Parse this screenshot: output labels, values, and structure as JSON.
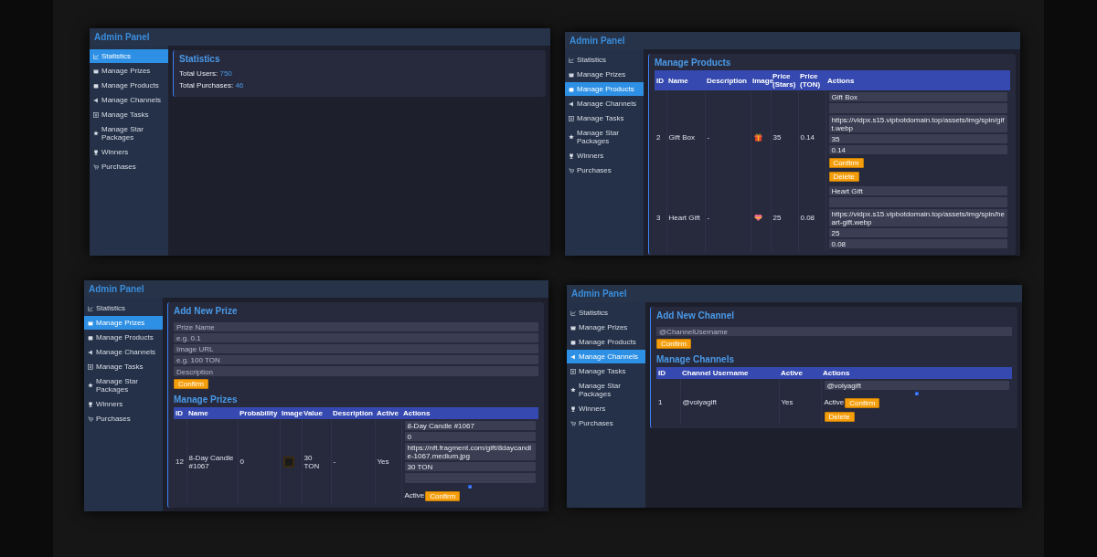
{
  "panels": [
    {
      "kind": "statistics",
      "title": "Admin Panel",
      "sidebar": [
        {
          "label": "Statistics",
          "selected": true
        },
        {
          "label": "Manage Prizes",
          "selected": false
        },
        {
          "label": "Manage Products",
          "selected": false
        },
        {
          "label": "Manage Channels",
          "selected": false
        },
        {
          "label": "Manage Tasks",
          "selected": false
        },
        {
          "label": "Manage Star Packages",
          "selected": false
        },
        {
          "label": "Winners",
          "selected": false
        },
        {
          "label": "Purchases",
          "selected": false
        }
      ],
      "heading": "Statistics",
      "stats": [
        {
          "label": "Total Users:",
          "value": "750"
        },
        {
          "label": "Total Purchases:",
          "value": "46"
        }
      ]
    },
    {
      "kind": "products",
      "title": "Admin Panel",
      "sidebar": [
        {
          "label": "Statistics",
          "selected": false
        },
        {
          "label": "Manage Prizes",
          "selected": false
        },
        {
          "label": "Manage Products",
          "selected": true
        },
        {
          "label": "Manage Channels",
          "selected": false
        },
        {
          "label": "Manage Tasks",
          "selected": false
        },
        {
          "label": "Manage Star Packages",
          "selected": false
        },
        {
          "label": "Winners",
          "selected": false
        },
        {
          "label": "Purchases",
          "selected": false
        }
      ],
      "table": {
        "heading": "Manage Products",
        "columns": [
          "ID",
          "Name",
          "Description",
          "Image",
          "Price (Stars)",
          "Price (TON)",
          "Actions"
        ],
        "rows": [
          {
            "cells": [
              {
                "kind": "text",
                "text": "2"
              },
              {
                "kind": "text",
                "text": "Gift Box"
              },
              {
                "kind": "text",
                "text": "-"
              },
              {
                "kind": "gift"
              },
              {
                "kind": "text",
                "text": "35"
              },
              {
                "kind": "text",
                "text": "0.14"
              }
            ],
            "edit": {
              "fields": [
                {
                  "kind": "input",
                  "value": "Gift Box"
                },
                {
                  "kind": "textarea"
                },
                {
                  "kind": "input",
                  "value": "https://vidpx.s15.vipbotdomain.top/assets/img/spin/gift.webp"
                },
                {
                  "kind": "input",
                  "value": "35"
                },
                {
                  "kind": "input",
                  "value": "0.14"
                }
              ],
              "buttons": [
                "Confirm",
                "Delete"
              ]
            }
          },
          {
            "cells": [
              {
                "kind": "text",
                "text": "3"
              },
              {
                "kind": "text",
                "text": "Heart Gift"
              },
              {
                "kind": "text",
                "text": "-"
              },
              {
                "kind": "heart"
              },
              {
                "kind": "text",
                "text": "25"
              },
              {
                "kind": "text",
                "text": "0.08"
              }
            ],
            "edit": {
              "fields": [
                {
                  "kind": "input",
                  "value": "Heart Gift"
                },
                {
                  "kind": "textarea"
                },
                {
                  "kind": "input",
                  "value": "https://vidpx.s15.vipbotdomain.top/assets/img/spin/heart-gift.webp"
                },
                {
                  "kind": "input",
                  "value": "25"
                },
                {
                  "kind": "input",
                  "value": "0.08"
                }
              ]
            }
          }
        ]
      }
    },
    {
      "kind": "prizes",
      "title": "Admin Panel",
      "sidebar": [
        {
          "label": "Statistics",
          "selected": false
        },
        {
          "label": "Manage Prizes",
          "selected": true
        },
        {
          "label": "Manage Products",
          "selected": false
        },
        {
          "label": "Manage Channels",
          "selected": false
        },
        {
          "label": "Manage Tasks",
          "selected": false
        },
        {
          "label": "Manage Star Packages",
          "selected": false
        },
        {
          "label": "Winners",
          "selected": false
        },
        {
          "label": "Purchases",
          "selected": false
        }
      ],
      "add_form": {
        "heading": "Add New Prize",
        "fields": [
          {
            "kind": "input",
            "placeholder": "Prize Name"
          },
          {
            "kind": "input",
            "placeholder": "e.g. 0.1"
          },
          {
            "kind": "input",
            "placeholder": "Image URL"
          },
          {
            "kind": "input",
            "placeholder": "e.g. 100 TON"
          },
          {
            "kind": "textarea",
            "placeholder": "Description"
          }
        ],
        "button": "Confirm"
      },
      "table": {
        "heading": "Manage Prizes",
        "columns": [
          "ID",
          "Name",
          "Probability",
          "Image",
          "Value",
          "Description",
          "Active",
          "Actions"
        ],
        "rows": [
          {
            "cells": [
              {
                "kind": "text",
                "text": "12"
              },
              {
                "kind": "text",
                "text": "8-Day Candle #1067"
              },
              {
                "kind": "text",
                "text": "0"
              },
              {
                "kind": "photo"
              },
              {
                "kind": "text",
                "text": "30 TON"
              },
              {
                "kind": "text",
                "text": "-"
              },
              {
                "kind": "text",
                "text": "Yes"
              }
            ],
            "edit": {
              "fields": [
                {
                  "kind": "input",
                  "value": "8-Day Candle #1067"
                },
                {
                  "kind": "input",
                  "value": "0"
                },
                {
                  "kind": "input",
                  "value": "https://nft.fragment.com/gift/8daycandle-1067.medium.jpg"
                },
                {
                  "kind": "input",
                  "value": "30 TON"
                },
                {
                  "kind": "textarea"
                }
              ],
              "checked": true,
              "active_label": "Active",
              "buttons": [
                "Confirm"
              ]
            }
          }
        ]
      }
    },
    {
      "kind": "channels",
      "title": "Admin Panel",
      "sidebar": [
        {
          "label": "Statistics",
          "selected": false
        },
        {
          "label": "Manage Prizes",
          "selected": false
        },
        {
          "label": "Manage Products",
          "selected": false
        },
        {
          "label": "Manage Channels",
          "selected": true
        },
        {
          "label": "Manage Tasks",
          "selected": false
        },
        {
          "label": "Manage Star Packages",
          "selected": false
        },
        {
          "label": "Winners",
          "selected": false
        },
        {
          "label": "Purchases",
          "selected": false
        }
      ],
      "add_form": {
        "heading": "Add New Channel",
        "fields": [
          {
            "kind": "input",
            "placeholder": "@ChannelUsername"
          }
        ],
        "button": "Confirm"
      },
      "table": {
        "heading": "Manage Channels",
        "columns": [
          "ID",
          "Channel Username",
          "Active",
          "Actions"
        ],
        "rows": [
          {
            "cells": [
              {
                "kind": "text",
                "text": "1"
              },
              {
                "kind": "text",
                "text": "@volyagift"
              },
              {
                "kind": "text",
                "text": "Yes"
              }
            ],
            "edit": {
              "fields": [
                {
                  "kind": "input",
                  "value": "@volyagift"
                }
              ],
              "checked": true,
              "active_label": "Active",
              "buttons": [
                "Confirm",
                "Delete"
              ]
            }
          }
        ]
      }
    }
  ]
}
